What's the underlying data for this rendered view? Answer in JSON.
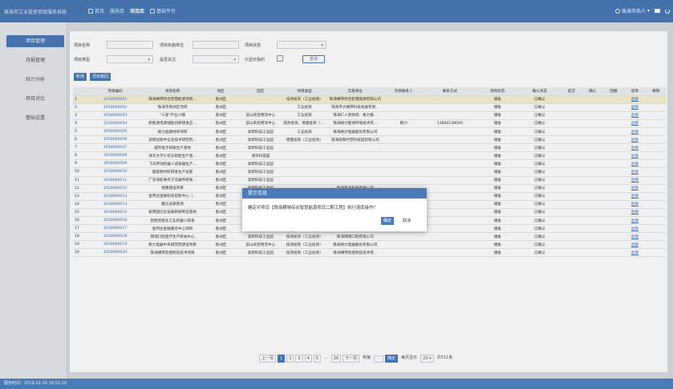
{
  "app": {
    "title": "珠海市工业投资项目服务系统"
  },
  "nav": [
    {
      "label": "首页",
      "icon": "home-icon"
    },
    {
      "label": "服务库",
      "icon": ""
    },
    {
      "label": "项目库",
      "icon": ""
    },
    {
      "label": "基础平台",
      "icon": "platform-icon"
    }
  ],
  "user": {
    "name": "珠海市局人",
    "icon": "user-icon"
  },
  "sidebar": {
    "items": [
      {
        "label": "项目管理",
        "active": true
      },
      {
        "label": "月报管理",
        "active": false
      },
      {
        "label": "统计分析",
        "active": false
      },
      {
        "label": "项目对比",
        "active": false
      },
      {
        "label": "基础设置",
        "active": false
      }
    ]
  },
  "filters": {
    "project_name": "项目名称",
    "impl_unit": "项目实施单位",
    "status": "项目状态",
    "type": "项目类型",
    "is_key": "是否关注",
    "is_mine": "只显示我的",
    "query": "查询"
  },
  "toolbar": {
    "add": "新增",
    "withdraw": "项目撤回"
  },
  "table": {
    "headers": [
      "",
      "项目编码",
      "项目名称",
      "地区",
      "园区",
      "项目类型",
      "实施单位",
      "项目联系人",
      "联系方式",
      "项目状态",
      "确认状态",
      "提交",
      "确认",
      "回撤",
      "退库",
      "撤销"
    ],
    "rows": [
      [
        "1",
        "2018000001",
        "珠海横琴综合智慧能源项目...",
        "香洲区",
        "",
        "技改投资（工业投资）",
        "珠海横琴综合智慧能源有限公司",
        "",
        "",
        "储备",
        "已确认",
        "",
        "",
        "",
        "退库",
        ""
      ],
      [
        "2",
        "2018000002",
        "珠海市香洲区项目",
        "香洲区",
        "",
        "工业投资",
        "珠海市大横琴科技发展有限...",
        "",
        "",
        "储备",
        "已确认",
        "",
        "",
        "",
        "退库",
        ""
      ],
      [
        "3",
        "2018000003",
        "\"三星\"产业小镇",
        "香洲区",
        "前山商贸物流中心",
        "工业投资",
        "珠海仁人民政府、格力集...",
        "",
        "",
        "储备",
        "已确认",
        "",
        "",
        "",
        "退库",
        ""
      ],
      [
        "4",
        "2018000004",
        "新能源电源储能创新研发应...",
        "香洲区",
        "前山商贸物流中心",
        "技改投资、增量投资（工...",
        "珠海格力能源环境技术有...",
        "格力",
        "13800138000",
        "储备",
        "已确认",
        "",
        "",
        "",
        "退库",
        ""
      ],
      [
        "5",
        "2018000005",
        "格力晶融地块项目",
        "香洲区",
        "高新科技工业园",
        "工业投资",
        "珠海格力电器股份有限公司",
        "",
        "",
        "储备",
        "已确认",
        "",
        "",
        "",
        "退库",
        ""
      ],
      [
        "6",
        "2018000006",
        "高铁创新中信息技术研究院...",
        "香洲区",
        "高新科技工业园",
        "增量投资（工业投资）",
        "珠海高铁时空科技园有限公司",
        "",
        "",
        "储备",
        "已确认",
        "",
        "",
        "",
        "退库",
        ""
      ],
      [
        "7",
        "2018000007",
        "城市电子研发生产基地",
        "香洲区",
        "高新科技工业园",
        "",
        "",
        "",
        "",
        "储备",
        "已确认",
        "",
        "",
        "",
        "退库",
        ""
      ],
      [
        "8",
        "2018000008",
        "清华大学小可乐智能生产基...",
        "香洲区",
        "清华科技园",
        "",
        "",
        "",
        "",
        "储备",
        "已确认",
        "",
        "",
        "",
        "退库",
        ""
      ],
      [
        "9",
        "2018000009",
        "飞马传动机器人减速器生产...",
        "香洲区",
        "高新科技工业园",
        "",
        "",
        "",
        "",
        "储备",
        "已确认",
        "",
        "",
        "",
        "退库",
        ""
      ],
      [
        "10",
        "2018000010",
        "国能新材料研发生产总部",
        "香洲区",
        "高新科技工业园",
        "",
        "",
        "",
        "",
        "储备",
        "已确认",
        "",
        "",
        "",
        "退库",
        ""
      ],
      [
        "11",
        "2018000011",
        "广东领航事务于元器件研发...",
        "香洲区",
        "高新科技工业园",
        "",
        "",
        "",
        "",
        "储备",
        "已确认",
        "",
        "",
        "",
        "退库",
        ""
      ],
      [
        "12",
        "2018000012",
        "德惠建设项目",
        "香洲区",
        "高新科技工业园",
        "",
        "珠海电子科技有限公司",
        "",
        "",
        "储备",
        "已确认",
        "",
        "",
        "",
        "退库",
        ""
      ],
      [
        "13",
        "2018000013",
        "金邦达金融科技智能中心（...",
        "香洲区",
        "前山商贸物流中心",
        "工业投资",
        "金邦达有限公司",
        "",
        "",
        "储备",
        "已确认",
        "",
        "",
        "",
        "退库",
        ""
      ],
      [
        "14",
        "2018000014",
        "雅信总部基地",
        "香洲区",
        "高新科技工业园",
        "增量投资（工业投资）",
        "珠海雅信智能设备有限公司",
        "",
        "",
        "储备",
        "已确认",
        "",
        "",
        "",
        "退库",
        ""
      ],
      [
        "15",
        "2018000015",
        "核用国信化设备研发制造基地",
        "香洲区",
        "高新科技工业园",
        "技改投资、增量投资（工...",
        "珠海核用智能制造有限公司",
        "",
        "",
        "储备",
        "已确认",
        "",
        "",
        "",
        "退库",
        ""
      ],
      [
        "16",
        "2018000016",
        "智能智能化工业机器人研发",
        "香洲区",
        "高新科技工业园",
        "技改投资、增量投资（工...",
        "珠海智能机器人科技有限",
        "",
        "",
        "储备",
        "已确认",
        "",
        "",
        "",
        "退库",
        ""
      ],
      [
        "17",
        "2018000017",
        "金邦达金融服务中心项目",
        "香洲区",
        "前山商贸物流中心",
        "技改投资（工业投资）",
        "金邦达有限公司",
        "",
        "",
        "储备",
        "已确认",
        "",
        "",
        "",
        "退库",
        ""
      ],
      [
        "18",
        "2018000018",
        "拜瑞口腔医疗生产研发中心",
        "香洲区",
        "高新科技工业园",
        "技改投资（工业投资）",
        "珠海拜瑞口腔有限公司",
        "",
        "",
        "储备",
        "已确认",
        "",
        "",
        "",
        "退库",
        ""
      ],
      [
        "19",
        "2018000019",
        "格力电器中央研究院建设项目",
        "香洲区",
        "前山商贸物流中心",
        "技改投资（工业投资）",
        "珠海格力电器股份有限公司",
        "",
        "",
        "储备",
        "已确认",
        "",
        "",
        "",
        "退库",
        ""
      ],
      [
        "20",
        "2018000020",
        "珠海横琴智能制造技术项目",
        "香洲区",
        "高新科技工业园",
        "技改投资（工业投资）",
        "珠海横琴智能制造技术有...",
        "",
        "",
        "储备",
        "已确认",
        "",
        "",
        "",
        "退库",
        ""
      ]
    ]
  },
  "pager": {
    "prev": "上一页",
    "pages": [
      "1",
      "2",
      "3",
      "4",
      "5"
    ],
    "ellipsis": "...",
    "last": "26",
    "next": "下一页",
    "goto": "到第",
    "go": "确定",
    "per_page_label": "每页显示",
    "per_page": "20",
    "total": "共511条"
  },
  "dialog": {
    "title": "提示信息",
    "message": "确定对项目【珠海横琴综合智慧能源项目二期工程】执行退库操作？",
    "ok": "确定",
    "cancel": "取消"
  },
  "footer": {
    "text": "服务时间：2019-11-16 10:52:10"
  }
}
